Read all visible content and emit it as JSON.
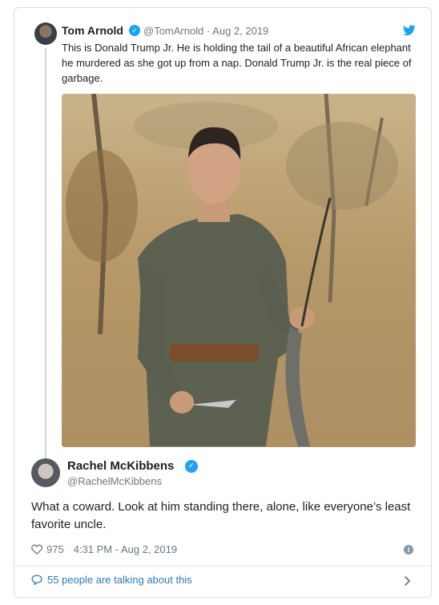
{
  "quoted_tweet": {
    "author_name": "Tom Arnold",
    "handle_date": "@TomArnold · Aug 2, 2019",
    "text": "This is Donald Trump Jr.  He is holding the tail of a beautiful African elephant he murdered as she got up from a nap. Donald Trump Jr. is the real piece of garbage.",
    "verified_glyph": "✓",
    "bird_icon": "twitter-bird-icon"
  },
  "main_tweet": {
    "author_name": "Rachel McKibbens",
    "handle": "@RachelMcKibbens",
    "verified_glyph": "✓",
    "text": "What a coward. Look at him standing there, alone, like everyone’s least favorite uncle.",
    "likes": "975",
    "timestamp": "4:31 PM - Aug 2, 2019",
    "info_glyph": "i"
  },
  "footer": {
    "talking_text": "55 people are talking about this"
  },
  "colors": {
    "accent": "#1da1f2",
    "link": "#2b7bb9",
    "muted": "#697882",
    "border": "#d9dde0"
  }
}
